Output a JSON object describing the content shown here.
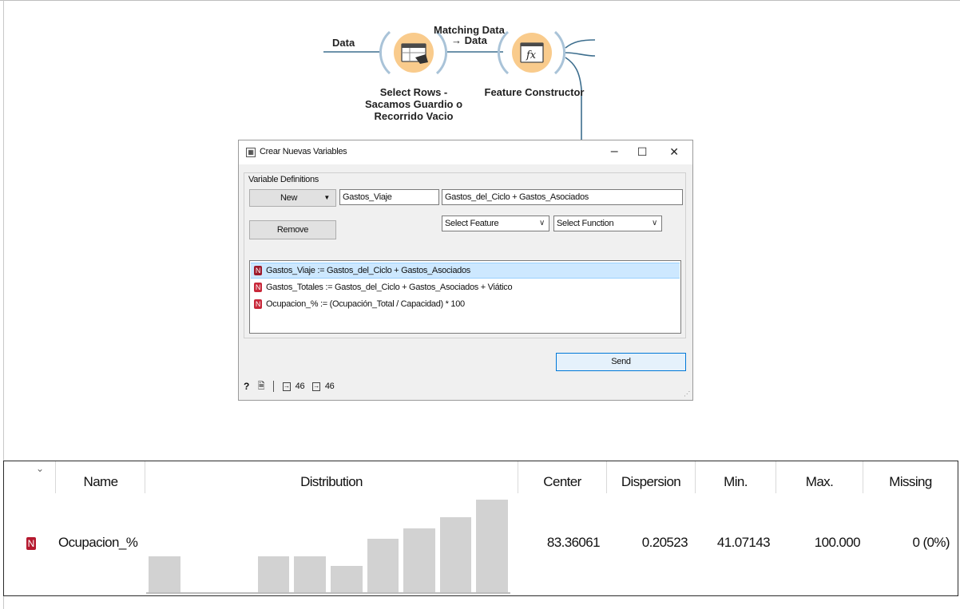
{
  "workflow": {
    "input_label": "Data",
    "link_label": "Matching Data\n→ Data",
    "nodes": [
      {
        "title": "Select Rows -\nSacamos Guardio o\nRecorrido Vacio",
        "icon": "select-rows-icon"
      },
      {
        "title": "Feature Constructor",
        "icon": "fx-icon"
      }
    ],
    "node_color": "#f9cb8c"
  },
  "dialog": {
    "title": "Crear Nuevas Variables",
    "controls": {
      "minimize": "–",
      "maximize": "☐",
      "close": "✕"
    },
    "group_title": "Variable Definitions",
    "new_button": "New",
    "remove_button": "Remove",
    "name_value": "Gastos_Viaje",
    "expression_value": "Gastos_del_Ciclo + Gastos_Asociados",
    "select_feature": "Select Feature",
    "select_function": "Select Function",
    "variables": [
      {
        "type": "N",
        "text": "Gastos_Viaje := Gastos_del_Ciclo + Gastos_Asociados",
        "selected": true
      },
      {
        "type": "N",
        "text": "Gastos_Totales := Gastos_del_Ciclo + Gastos_Asociados + Viático",
        "selected": false
      },
      {
        "type": "N",
        "text": "Ocupacion_% := (Ocupación_Total / Capacidad) * 100",
        "selected": false
      }
    ],
    "send_button": "Send",
    "status": {
      "help": "?",
      "report": "🗎",
      "input_count": "46",
      "output_count": "46"
    }
  },
  "table": {
    "headers": [
      "Name",
      "Distribution",
      "Center",
      "Dispersion",
      "Min.",
      "Max.",
      "Missing"
    ],
    "row": {
      "type": "N",
      "name": "Ocupacion_%",
      "center": "83.36061",
      "dispersion": "0.20523",
      "min": "41.07143",
      "max": "100.000",
      "missing": "0 (0%)"
    },
    "distribution": [
      2,
      0,
      0,
      2,
      2,
      1.5,
      3,
      3.6,
      4.2,
      5.2
    ],
    "accent": "#9e1b2c"
  }
}
